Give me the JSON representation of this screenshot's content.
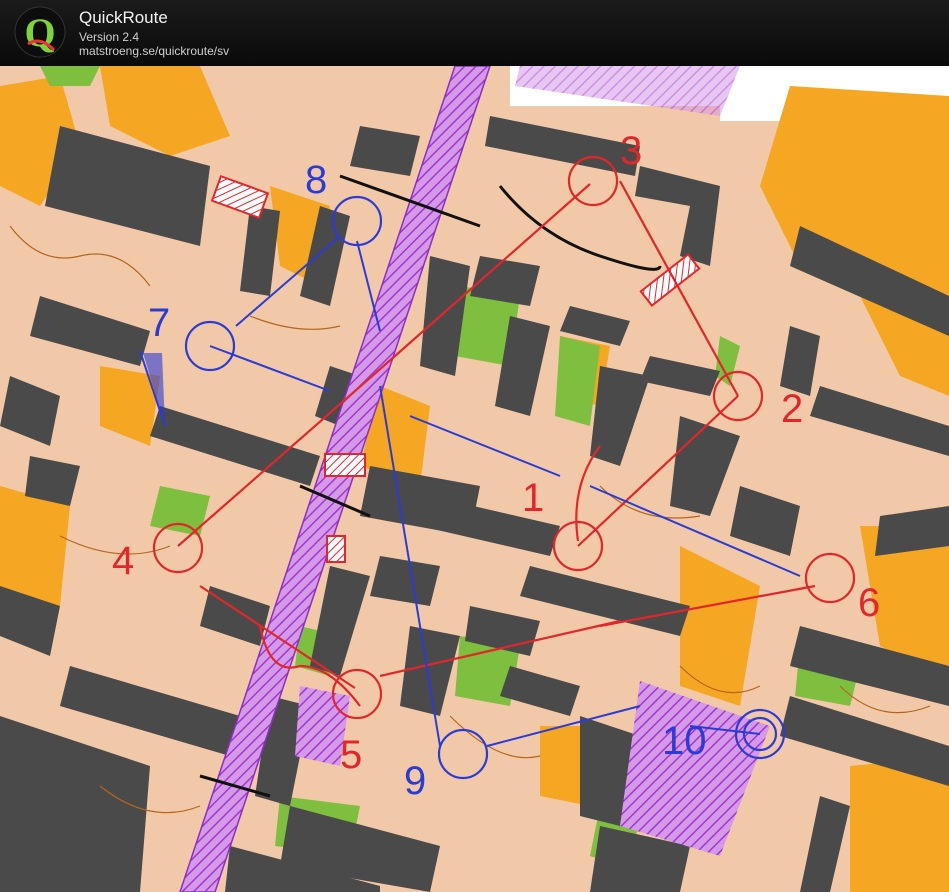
{
  "header": {
    "app_name": "QuickRoute",
    "version": "Version 2.4",
    "url": "matstroeng.se/quickroute/sv"
  },
  "map": {
    "colors": {
      "ground": "#f2c9a8",
      "building": "#4a4a4a",
      "vegetation": "#7fbf3f",
      "open_land": "#f5a623",
      "road_purple": "#b44be0",
      "route_red": "#e3262b",
      "route_blue": "#2b3bd6",
      "contour": "#b5651d"
    },
    "course_red": {
      "controls": [
        "1",
        "2",
        "3",
        "4",
        "5",
        "6"
      ]
    },
    "course_blue": {
      "controls": [
        "7",
        "8",
        "9",
        "10"
      ]
    }
  }
}
